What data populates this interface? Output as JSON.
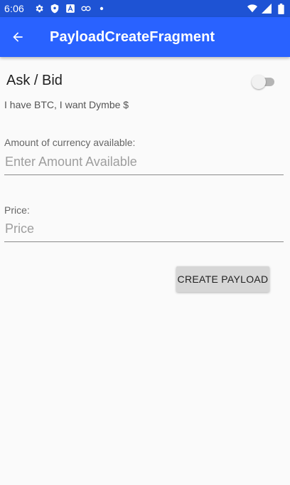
{
  "status_bar": {
    "time": "6:06",
    "icons_left": [
      "settings-icon",
      "shield-icon",
      "android-icon",
      "link-icon",
      "dot-icon"
    ],
    "icons_right": [
      "wifi-icon",
      "signal-icon",
      "battery-icon"
    ]
  },
  "app_bar": {
    "title": "PayloadCreateFragment",
    "back_icon": "arrow-back-icon",
    "color": "#2962ff"
  },
  "form": {
    "ask_bid_label": "Ask / Bid",
    "ask_bid_switch_on": false,
    "subtitle": "I have BTC, I want Dymbe $",
    "amount_label": "Amount of currency available:",
    "amount_value": "",
    "amount_placeholder": "Enter Amount Available",
    "price_label": "Price:",
    "price_value": "",
    "price_placeholder": "Price",
    "create_button": "CREATE PAYLOAD"
  }
}
